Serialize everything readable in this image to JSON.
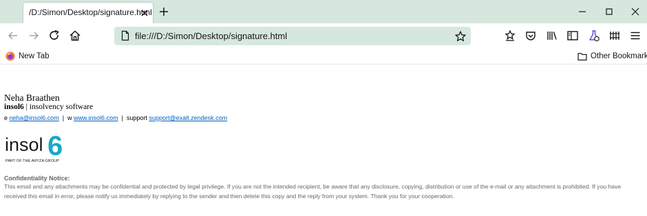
{
  "browser": {
    "tab_title": "/D:/Simon/Desktop/signature.html",
    "url": "file:///D:/Simon/Desktop/signature.html",
    "bookmarks": {
      "new_tab": "New Tab",
      "other": "Other Bookmarks"
    },
    "theme": {
      "chrome": "#d6e8de",
      "text": "#15141a"
    }
  },
  "signature": {
    "name": "Neha Braathen",
    "company_bold": "insol6",
    "company_rest": " | insolvency software",
    "email_prefix": "e ",
    "email": "neha@insol6.com",
    "sep1": "  |  w ",
    "website": "www.insol6.com",
    "sep2": "  |  support ",
    "support": "support@exalt.zendesk.com",
    "logo_text": "insol",
    "logo_digit": "6",
    "logo_tagline": "PART OF THE ARYZA GROUP",
    "logo_colors": {
      "text": "#1a1a1a",
      "accent": "#19a9c6"
    },
    "confidentiality_title": "Confidentiality Notice:",
    "confidentiality_body": "This email and any attachments may be confidential and protected by legal privilege. If you are not the intended recipient, be aware that any disclosure, copying, distribution or use of the e-mail or any attachment is prohibited. If you have received this email in error, please notify us immediately by replying to the sender and then delete this copy and the reply from your system. Thank you for your cooperation."
  }
}
